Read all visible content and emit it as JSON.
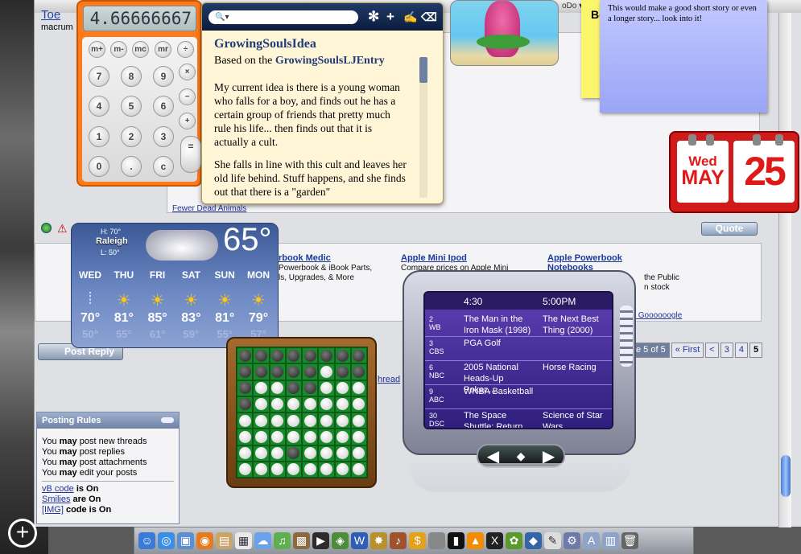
{
  "browser": {
    "top_text": "oDo ▾",
    "poster_name": "Toe",
    "poster_sub": "macrum"
  },
  "post": {
    "link_text": "Fewer Dead Animals",
    "quote_label": "Quote"
  },
  "ads": [
    {
      "title": "rbook Medic",
      "desc1": "Powerbook & iBook Parts,",
      "desc2": "ls, Upgrades, & More"
    },
    {
      "title": "Apple Mini Ipod",
      "desc1": "Compare prices on Apple Mini"
    },
    {
      "title": "Apple Powerbook",
      "desc1": "Notebooks",
      "desc2": "the Public",
      "desc3": "n stock"
    }
  ],
  "ads_google": "y Goooooogle",
  "post_reply": "Post Reply",
  "pager": {
    "label": "e 5 of 5",
    "first": "« First",
    "prev": "<",
    "p3": "3",
    "p4": "4",
    "p5": "5"
  },
  "thread_text": "hread",
  "rules": {
    "title": "Posting Rules",
    "may": "may",
    "lines": [
      {
        "pre": "You",
        "post": "post new threads"
      },
      {
        "pre": "You",
        "post": "post replies"
      },
      {
        "pre": "You",
        "post": "post attachments"
      },
      {
        "pre": "You",
        "post": "edit your posts"
      }
    ],
    "vb_link": "vB code",
    "vb_state": "is On",
    "smilies_link": "Smilies",
    "smilies_state": "are On",
    "img_link": "[IMG]",
    "img_state": "code is On"
  },
  "calculator": {
    "display": "4.66666667",
    "keys": [
      "m+",
      "m-",
      "mc",
      "mr",
      "÷",
      "7",
      "8",
      "9",
      "×",
      "4",
      "5",
      "6",
      "−",
      "1",
      "2",
      "3",
      "+",
      "0",
      ".",
      "c",
      "="
    ]
  },
  "notes": {
    "search_placeholder": "",
    "title": "GrowingSoulsIdea",
    "based_prefix": "Based on the",
    "based_link": "GrowingSoulsLJEntry",
    "para1": "My current idea is there is a young woman who falls for a boy, and finds out he has a certain group of friends that pretty much rule his life... then finds out that it is actually a cult.",
    "para2": "She falls in line with this cult and leaves her old life behind. Stuff happens, and she finds out that there is a \"garden\""
  },
  "sticky": {
    "yellow_text": "Be",
    "blue_text": "This would make a good short story or even a longer story... look into it!"
  },
  "calendar": {
    "day": "Wed",
    "month": "MAY",
    "date": "25"
  },
  "weather": {
    "city": "Raleigh",
    "high": "H: 70°",
    "low": "L: 50°",
    "current": "65°",
    "days": [
      {
        "d": "WED",
        "hi": "70°",
        "lo": "50°",
        "icon": "rain-icon"
      },
      {
        "d": "THU",
        "hi": "81°",
        "lo": "55°",
        "icon": "partly-sunny-icon"
      },
      {
        "d": "FRI",
        "hi": "85°",
        "lo": "61°",
        "icon": "sunny-icon"
      },
      {
        "d": "SAT",
        "hi": "83°",
        "lo": "59°",
        "icon": "partly-sunny-icon"
      },
      {
        "d": "SUN",
        "hi": "81°",
        "lo": "55°",
        "icon": "partly-sunny-icon"
      },
      {
        "d": "MON",
        "hi": "79°",
        "lo": "57°",
        "icon": "partly-sunny-icon"
      }
    ]
  },
  "othello": {
    "board": [
      "bbbbbbbb",
      "bbbbbwbb",
      "bwwbbwww",
      "bwwwwwww",
      "wwwwwwww",
      "wwwwwwww",
      "wwwbwwww",
      "wwwwwwww"
    ]
  },
  "tv": {
    "t1": "4:30",
    "t2": "5:00PM",
    "rows": [
      {
        "ch": "2",
        "net": "WB",
        "a": "The Man in the Iron Mask (1998)",
        "b": "The Next Best Thing (2000)"
      },
      {
        "ch": "3",
        "net": "CBS",
        "a": "PGA Golf",
        "b": ""
      },
      {
        "ch": "6",
        "net": "NBC",
        "a": "2005 National Heads-Up Poker....",
        "b": "Horse Racing"
      },
      {
        "ch": "9",
        "net": "ABC",
        "a": "WNBA Basketball",
        "b": ""
      },
      {
        "ch": "30",
        "net": "DSC",
        "a": "The Space Shuttle: Return to....",
        "b": "Science of Star Wars"
      }
    ]
  },
  "dock_icons": [
    "finder-icon",
    "safari-icon",
    "preview-icon",
    "firefox-icon",
    "address-book-icon",
    "ical-icon",
    "ichat-icon",
    "itunes-icon",
    "iphoto-icon",
    "imovie-icon",
    "idvd-icon",
    "word-icon",
    "garageband-icon",
    "guitar-icon",
    "money-icon",
    "apple-icon",
    "terminal-icon",
    "vlc-icon",
    "x11-icon",
    "frog-icon",
    "web-icon",
    "script-icon",
    "utilities-icon",
    "applications-icon",
    "documents-icon",
    "trash-icon"
  ]
}
